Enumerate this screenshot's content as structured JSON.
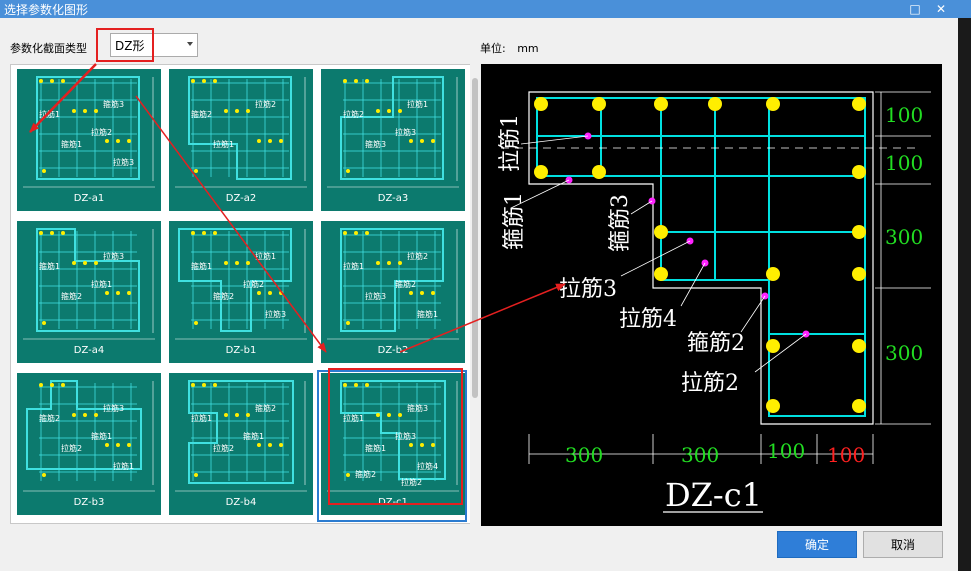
{
  "window": {
    "title": "选择参数化图形",
    "restore_glyph": "□",
    "close_glyph": "✕"
  },
  "form": {
    "type_label": "参数化截面类型",
    "type_value": "DZ形",
    "unit_label": "单位:",
    "unit_value": "mm"
  },
  "thumbnails": [
    {
      "caption": "DZ-a1",
      "labels": [
        "拉筋1",
        "箍筋1",
        "箍筋3",
        "拉筋2",
        "拉筋3"
      ]
    },
    {
      "caption": "DZ-a2",
      "labels": [
        "箍筋2",
        "拉筋1",
        "拉筋2"
      ]
    },
    {
      "caption": "DZ-a3",
      "labels": [
        "拉筋2",
        "箍筋3",
        "拉筋1",
        "拉筋3"
      ]
    },
    {
      "caption": "DZ-a4",
      "labels": [
        "箍筋1",
        "箍筋2",
        "拉筋3",
        "拉筋1"
      ]
    },
    {
      "caption": "DZ-b1",
      "labels": [
        "箍筋1",
        "箍筋2",
        "拉筋1",
        "拉筋2",
        "拉筋3"
      ]
    },
    {
      "caption": "DZ-b2",
      "labels": [
        "拉筋1",
        "拉筋3",
        "拉筋2",
        "箍筋2",
        "箍筋1"
      ]
    },
    {
      "caption": "DZ-b3",
      "labels": [
        "箍筋2",
        "拉筋2",
        "拉筋3",
        "箍筋1",
        "拉筋1"
      ]
    },
    {
      "caption": "DZ-b4",
      "labels": [
        "拉筋1",
        "拉筋2",
        "箍筋2",
        "箍筋1"
      ]
    },
    {
      "caption": "DZ-c1",
      "labels": [
        "拉筋1",
        "箍筋1",
        "箍筋3",
        "拉筋3",
        "拉筋4",
        "箍筋2",
        "拉筋2"
      ]
    }
  ],
  "preview": {
    "title": "DZ-c1",
    "labels": [
      "拉筋1",
      "箍筋1",
      "箍筋3",
      "拉筋3",
      "拉筋4",
      "箍筋2",
      "拉筋2"
    ],
    "dims_right": [
      "100",
      "100",
      "300",
      "300"
    ],
    "dims_bottom": [
      "300",
      "300",
      "100",
      "100"
    ],
    "colors": {
      "bar": "#00e0e0",
      "dot": "#ffee00",
      "dim_green": "#22dd22",
      "dim_red": "#ff2020",
      "marker": "#ff22ff"
    }
  },
  "buttons": {
    "ok": "确定",
    "cancel": "取消"
  }
}
